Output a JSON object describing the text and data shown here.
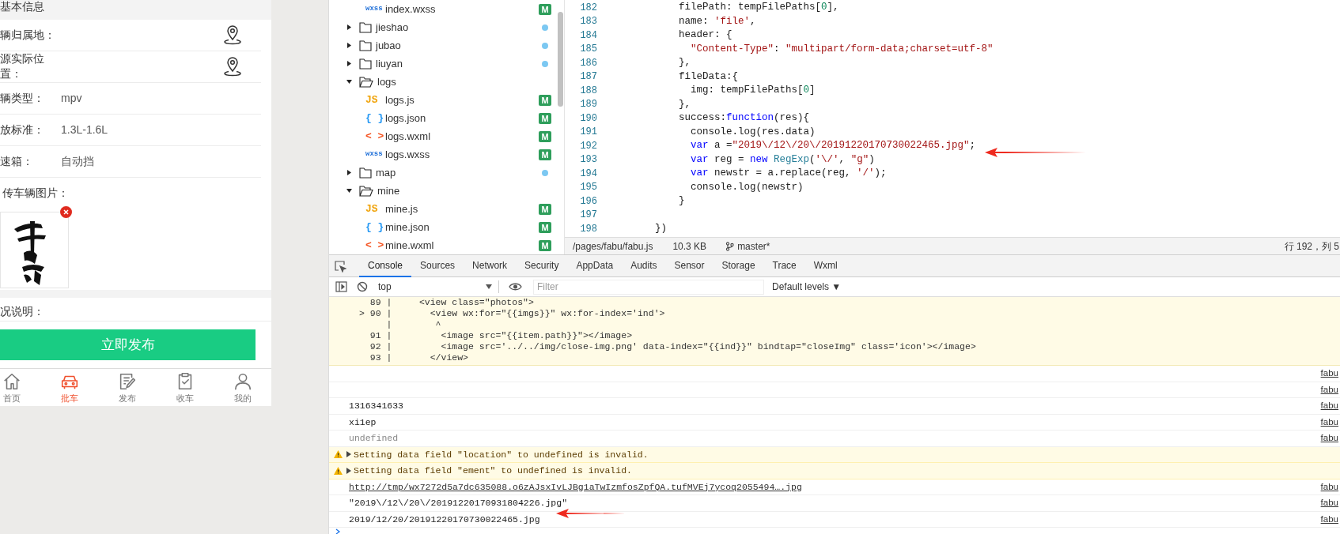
{
  "phone": {
    "section_title": "基本信息",
    "fields": [
      {
        "kind": "location",
        "label": "辆归属地："
      },
      {
        "kind": "location",
        "label": "源实际位置："
      },
      {
        "kind": "value",
        "label": "辆类型：",
        "value": "mpv"
      },
      {
        "kind": "value",
        "label": "放标准：",
        "value": "1.3L-1.6L"
      },
      {
        "kind": "value",
        "label": "速箱：",
        "value": "自动挡"
      }
    ],
    "upload": {
      "label": "传车辆图片：",
      "images": [
        {
          "kind": "picture",
          "removable": true
        }
      ]
    },
    "notes_label": "况说明：",
    "publish_button": "立即发布",
    "tab_bar": [
      {
        "label": "首页",
        "selected": false
      },
      {
        "label": "批车",
        "selected": true
      },
      {
        "label": "发布",
        "selected": false
      },
      {
        "label": "收车",
        "selected": false
      },
      {
        "label": "我的",
        "selected": false
      }
    ]
  },
  "file_tree": {
    "continued_children": [
      {
        "kind": "file",
        "name": "index.wxss",
        "color": "#1e6fd8",
        "icon_text": "wxss",
        "badge": "M"
      }
    ],
    "items": [
      {
        "kind": "folder",
        "name": "jieshao",
        "expanded": false,
        "changed": true
      },
      {
        "kind": "folder",
        "name": "jubao",
        "expanded": false,
        "changed": true
      },
      {
        "kind": "folder",
        "name": "liuyan",
        "expanded": false,
        "changed": true
      },
      {
        "kind": "folder",
        "name": "logs",
        "expanded": true,
        "changed": false,
        "children": [
          {
            "kind": "file",
            "name": "logs.js",
            "color": "#f0a30a",
            "icon_text": "JS",
            "badge": "M"
          },
          {
            "kind": "file",
            "name": "logs.json",
            "color": "#2196f3",
            "icon_text": "{ }",
            "badge": "M"
          },
          {
            "kind": "file",
            "name": "logs.wxml",
            "color": "#f4511e",
            "icon_text": "< >",
            "badge": "M"
          },
          {
            "kind": "file",
            "name": "logs.wxss",
            "color": "#1e6fd8",
            "icon_text": "wxss",
            "badge": "M"
          }
        ]
      },
      {
        "kind": "folder",
        "name": "map",
        "expanded": false,
        "changed": true
      },
      {
        "kind": "folder",
        "name": "mine",
        "expanded": true,
        "changed": false,
        "children": [
          {
            "kind": "file",
            "name": "mine.js",
            "color": "#f0a30a",
            "icon_text": "JS",
            "badge": "M"
          },
          {
            "kind": "file",
            "name": "mine.json",
            "color": "#2196f3",
            "icon_text": "{ }",
            "badge": "M"
          },
          {
            "kind": "file",
            "name": "mine.wxml",
            "color": "#f4511e",
            "icon_text": "< >",
            "badge": "M"
          }
        ]
      }
    ]
  },
  "editor": {
    "lines": [
      {
        "number": "182",
        "tokens": [
          {
            "kind": "plain",
            "text": "          filePath: tempFilePaths["
          },
          {
            "kind": "number",
            "text": "0"
          },
          {
            "kind": "plain",
            "text": "],"
          }
        ]
      },
      {
        "number": "183",
        "tokens": [
          {
            "kind": "plain",
            "text": "          name: "
          },
          {
            "kind": "string",
            "text": "'file'"
          },
          {
            "kind": "plain",
            "text": ","
          }
        ]
      },
      {
        "number": "184",
        "tokens": [
          {
            "kind": "plain",
            "text": "          header: {"
          }
        ]
      },
      {
        "number": "185",
        "tokens": [
          {
            "kind": "string",
            "text": "            \"Content-Type\""
          },
          {
            "kind": "plain",
            "text": ": "
          },
          {
            "kind": "string",
            "text": "\"multipart/form-data;charset=utf-8\""
          }
        ]
      },
      {
        "number": "186",
        "tokens": [
          {
            "kind": "plain",
            "text": "          },"
          }
        ]
      },
      {
        "number": "187",
        "tokens": [
          {
            "kind": "plain",
            "text": "          fileData:{"
          }
        ]
      },
      {
        "number": "188",
        "tokens": [
          {
            "kind": "plain",
            "text": "            img: tempFilePaths["
          },
          {
            "kind": "number",
            "text": "0"
          },
          {
            "kind": "plain",
            "text": "]"
          }
        ]
      },
      {
        "number": "189",
        "tokens": [
          {
            "kind": "plain",
            "text": "          },"
          }
        ]
      },
      {
        "number": "190",
        "tokens": [
          {
            "kind": "plain",
            "text": "          success:"
          },
          {
            "kind": "keyword",
            "text": "function"
          },
          {
            "kind": "plain",
            "text": "(res){"
          }
        ]
      },
      {
        "number": "191",
        "tokens": [
          {
            "kind": "plain",
            "text": "            console.log(res.data)"
          }
        ]
      },
      {
        "number": "192",
        "tokens": [
          {
            "kind": "keyword",
            "text": "            var"
          },
          {
            "kind": "plain",
            "text": " a ="
          },
          {
            "kind": "string",
            "text": "\"2019\\/12\\/20\\/20191220170730022465.jpg\""
          },
          {
            "kind": "plain",
            "text": ";"
          }
        ]
      },
      {
        "number": "193",
        "tokens": [
          {
            "kind": "keyword",
            "text": "            var"
          },
          {
            "kind": "plain",
            "text": " reg = "
          },
          {
            "kind": "keyword",
            "text": "new "
          },
          {
            "kind": "type",
            "text": "RegExp"
          },
          {
            "kind": "plain",
            "text": "("
          },
          {
            "kind": "string",
            "text": "'\\/'"
          },
          {
            "kind": "plain",
            "text": ", "
          },
          {
            "kind": "string",
            "text": "\"g\""
          },
          {
            "kind": "plain",
            "text": ")"
          }
        ]
      },
      {
        "number": "194",
        "tokens": [
          {
            "kind": "keyword",
            "text": "            var"
          },
          {
            "kind": "plain",
            "text": " newstr = a.replace(reg, "
          },
          {
            "kind": "string",
            "text": "'/'"
          },
          {
            "kind": "plain",
            "text": ");"
          }
        ]
      },
      {
        "number": "195",
        "tokens": [
          {
            "kind": "plain",
            "text": "            console.log(newstr)"
          }
        ]
      },
      {
        "number": "196",
        "tokens": [
          {
            "kind": "plain",
            "text": "          }"
          }
        ]
      },
      {
        "number": "197"
      },
      {
        "number": "198",
        "tokens": [
          {
            "kind": "plain",
            "text": "      })"
          }
        ]
      }
    ],
    "status": {
      "path": "/pages/fabu/fabu.js",
      "size": "10.3 KB",
      "branch": "master*",
      "position": "行 192，列 5"
    }
  },
  "devtools": {
    "tabs": [
      {
        "label": "Console",
        "selected": true
      },
      {
        "label": "Sources",
        "selected": false
      },
      {
        "label": "Network",
        "selected": false
      },
      {
        "label": "Security",
        "selected": false
      },
      {
        "label": "AppData",
        "selected": false
      },
      {
        "label": "Audits",
        "selected": false
      },
      {
        "label": "Sensor",
        "selected": false
      },
      {
        "label": "Storage",
        "selected": false
      },
      {
        "label": "Trace",
        "selected": false
      },
      {
        "label": "Wxml",
        "selected": false
      }
    ],
    "context": "top",
    "filter_placeholder": "Filter",
    "levels": "Default levels ▼",
    "code_frame": [
      "  89 |     <view class=\"photos\">",
      "> 90 |       <view wx:for=\"{{imgs}}\" wx:for-index='ind'>",
      "     |        ^",
      "  91 |         <image src=\"{{item.path}}\"></image>",
      "  92 |         <image src='../../img/close-img.png' data-index=\"{{ind}}\" bindtap=\"closeImg\" class='icon'></image>",
      "  93 |       </view>"
    ],
    "messages": [
      {
        "kind": "log",
        "source": "fabu"
      },
      {
        "kind": "log",
        "source": "fabu"
      },
      {
        "kind": "log",
        "text": "1316341633",
        "source": "fabu"
      },
      {
        "kind": "log",
        "text": "xi1ep",
        "source": "fabu"
      },
      {
        "kind": "muted",
        "text": "undefined",
        "source": "fabu"
      },
      {
        "kind": "warning",
        "text": "Setting data field \"location\" to undefined is invalid."
      },
      {
        "kind": "warning",
        "text": "Setting data field \"ement\" to undefined is invalid."
      },
      {
        "kind": "link",
        "text": "http://tmp/wx7272d5a7dc635088.o6zAJsxIvLJBg1aTwIzmfosZpfQA.tufMVEj7ycoq2055494….jpg",
        "source": "fabu"
      },
      {
        "kind": "log",
        "text": "\"2019\\/12\\/20\\/20191220170931804226.jpg\"",
        "source": "fabu"
      },
      {
        "kind": "log",
        "text": "2019/12/20/20191220170730022465.jpg",
        "source": "fabu"
      }
    ]
  }
}
